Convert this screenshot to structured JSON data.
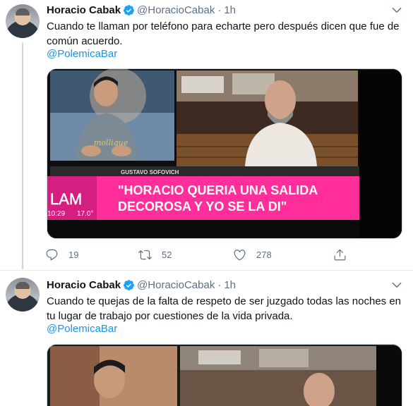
{
  "tweets": [
    {
      "author_name": "Horacio Cabak",
      "handle": "@HoracioCabak",
      "separator": "·",
      "time": "1h",
      "text": "Cuando te llaman por teléfono para echarte pero después dicen que fue de común acuerdo.",
      "mention": "@PolemicaBar",
      "media": {
        "guest_name": "GUSTAVO SOFOVICH",
        "headline_line1": "\"HORACIO QUERIA UNA SALIDA",
        "headline_line2": "DECOROSA Y YO SE LA DI\"",
        "logo": "LAM",
        "clock": "10:29",
        "temp": "17.0°",
        "shirt_text": "mollique"
      },
      "replies": "19",
      "retweets": "52",
      "likes": "278"
    },
    {
      "author_name": "Horacio Cabak",
      "handle": "@HoracioCabak",
      "separator": "·",
      "time": "1h",
      "text": "Cuando te quejas de la falta de respeto de ser juzgado todas las noches en tu lugar de trabajo por cuestiones de la vida privada.",
      "mention": "@PolemicaBar"
    }
  ],
  "colors": {
    "accent": "#1b95e0",
    "verified": "#1da1f2",
    "muted": "#5b7083",
    "banner_pink": "#ff2e9a"
  },
  "icons": [
    "verified-badge-icon",
    "chevron-down-icon",
    "reply-icon",
    "retweet-icon",
    "like-icon",
    "share-icon"
  ]
}
